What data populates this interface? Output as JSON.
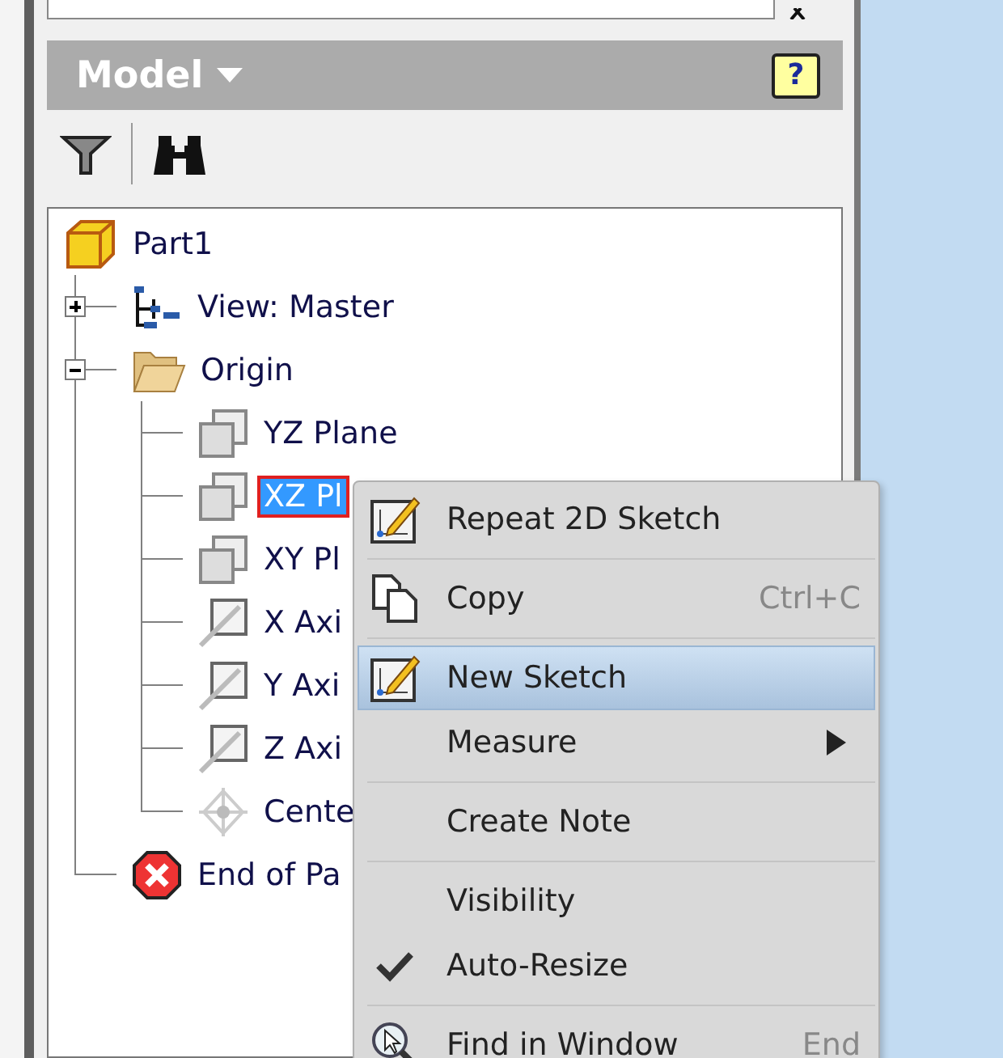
{
  "panel": {
    "title": "Model",
    "help_label": "?"
  },
  "toolbar": {
    "tools": [
      {
        "kind": "filter"
      },
      {
        "kind": "find"
      }
    ]
  },
  "tree": [
    {
      "label": "Part1",
      "kind": "part",
      "selected": false,
      "children": [
        {
          "label": "View: Master",
          "kind": "view",
          "expanded": false,
          "selected": false
        },
        {
          "label": "Origin",
          "kind": "folder",
          "expanded": true,
          "selected": false,
          "children": [
            {
              "label": "YZ Plane",
              "kind": "plane",
              "selected": false
            },
            {
              "label": "XZ Pl",
              "kind": "plane",
              "selected": true
            },
            {
              "label": "XY Pl",
              "kind": "plane",
              "selected": false
            },
            {
              "label": "X Axi",
              "kind": "axis",
              "selected": false
            },
            {
              "label": "Y Axi",
              "kind": "axis",
              "selected": false
            },
            {
              "label": "Z Axi",
              "kind": "axis",
              "selected": false
            },
            {
              "label": "Cente",
              "kind": "point",
              "selected": false
            }
          ]
        },
        {
          "label": "End of Pa",
          "kind": "end",
          "selected": false
        }
      ]
    }
  ],
  "context_menu": {
    "groups": [
      {
        "items": [
          {
            "label": "Repeat 2D Sketch",
            "kind": "sketch",
            "selected": false
          }
        ]
      },
      {
        "items": [
          {
            "label": "Copy",
            "kind": "copy",
            "shortcut": "Ctrl+C",
            "selected": false
          }
        ]
      },
      {
        "items": [
          {
            "label": "New Sketch",
            "kind": "sketch",
            "selected": true
          },
          {
            "label": "Measure",
            "kind": "plain",
            "submenu": true,
            "selected": false
          }
        ]
      },
      {
        "items": [
          {
            "label": "Create Note",
            "kind": "plain",
            "selected": false
          }
        ]
      },
      {
        "items": [
          {
            "label": "Visibility",
            "kind": "plain",
            "checked": false,
            "selected": false
          },
          {
            "label": "Auto-Resize",
            "kind": "plain",
            "checked": true,
            "selected": false
          }
        ]
      },
      {
        "items": [
          {
            "label": "Find in Window",
            "kind": "find",
            "shortcut": "End",
            "selected": false
          }
        ]
      }
    ]
  }
}
